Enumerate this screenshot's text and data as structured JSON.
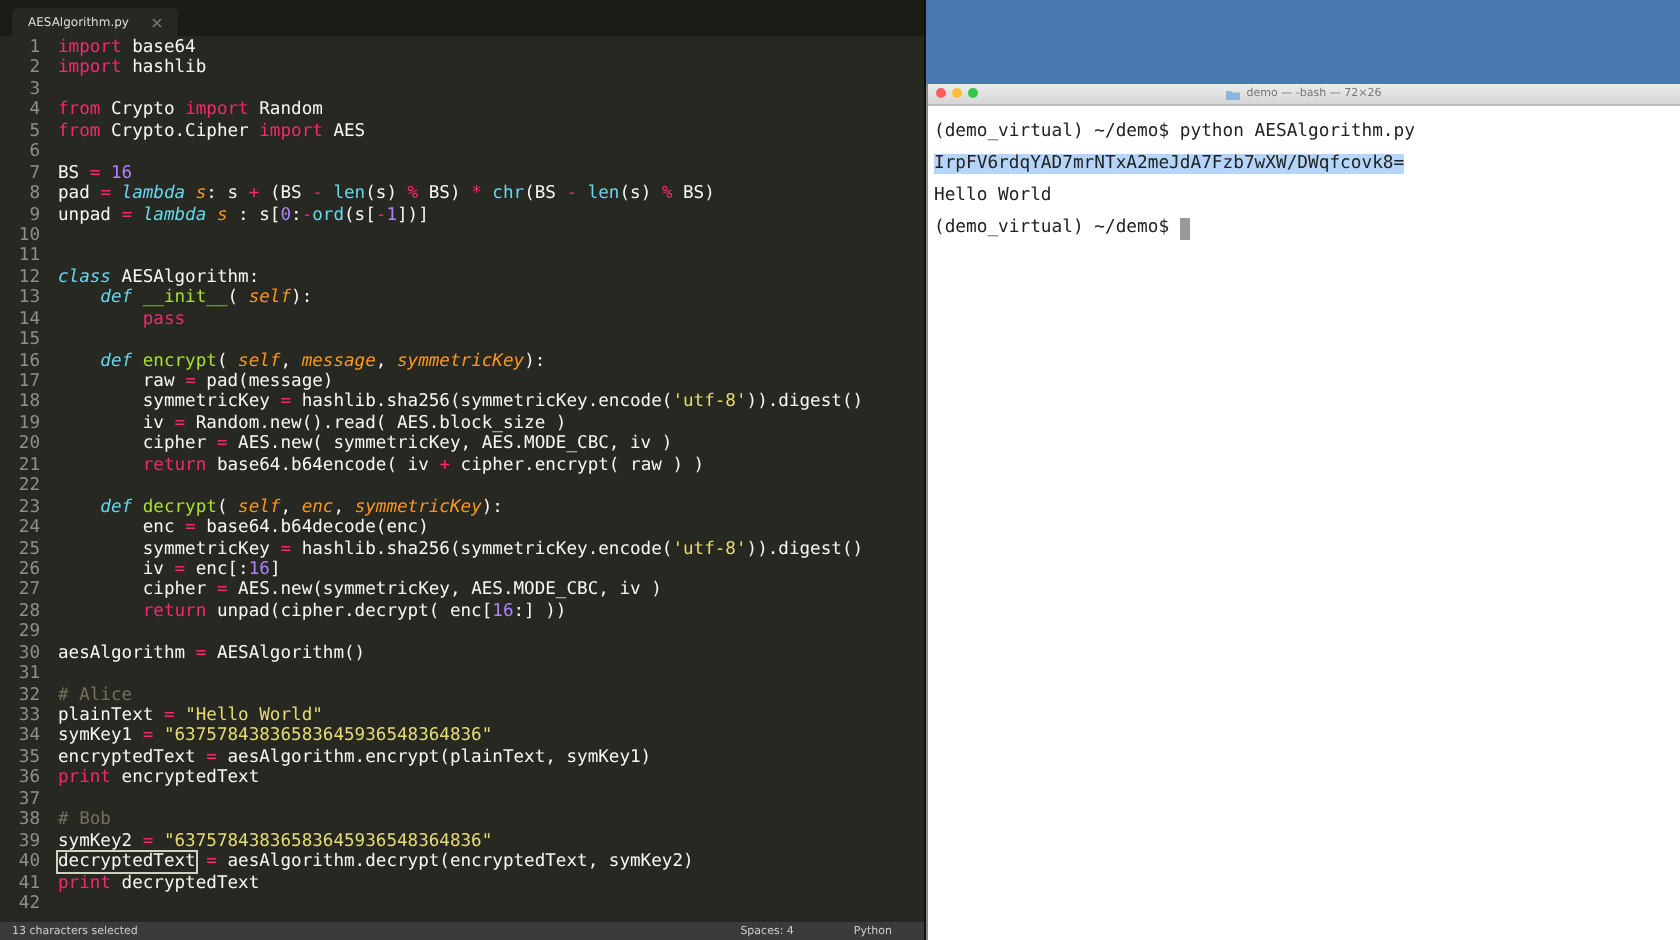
{
  "editor": {
    "tab": {
      "label": "AESAlgorithm.py",
      "selected": true
    },
    "lines": [
      {
        "number": "1",
        "tokens": [
          {
            "kind": "keyword",
            "text": "import "
          },
          {
            "kind": "plain",
            "text": "base64"
          }
        ]
      },
      {
        "number": "2",
        "tokens": [
          {
            "kind": "keyword",
            "text": "import "
          },
          {
            "kind": "plain",
            "text": "hashlib"
          }
        ]
      },
      {
        "number": "3"
      },
      {
        "number": "4",
        "tokens": [
          {
            "kind": "keyword",
            "text": "from "
          },
          {
            "kind": "plain",
            "text": "Crypto "
          },
          {
            "kind": "keyword",
            "text": "import "
          },
          {
            "kind": "plain",
            "text": "Random"
          }
        ]
      },
      {
        "number": "5",
        "tokens": [
          {
            "kind": "keyword",
            "text": "from "
          },
          {
            "kind": "plain",
            "text": "Crypto.Cipher "
          },
          {
            "kind": "keyword",
            "text": "import "
          },
          {
            "kind": "plain",
            "text": "AES"
          }
        ]
      },
      {
        "number": "6"
      },
      {
        "number": "7",
        "tokens": [
          {
            "kind": "plain",
            "text": "BS "
          },
          {
            "kind": "keyword",
            "text": "= "
          },
          {
            "kind": "number",
            "text": "16"
          }
        ]
      },
      {
        "number": "8",
        "tokens": [
          {
            "kind": "plain",
            "text": "pad "
          },
          {
            "kind": "keyword",
            "text": "= "
          },
          {
            "kind": "storage",
            "text": "lambda "
          },
          {
            "kind": "parameter",
            "text": "s"
          },
          {
            "kind": "plain",
            "text": ": s "
          },
          {
            "kind": "keyword",
            "text": "+ "
          },
          {
            "kind": "plain",
            "text": "(BS "
          },
          {
            "kind": "keyword",
            "text": "- "
          },
          {
            "kind": "builtin",
            "text": "len"
          },
          {
            "kind": "plain",
            "text": "(s) "
          },
          {
            "kind": "keyword",
            "text": "% "
          },
          {
            "kind": "plain",
            "text": "BS) "
          },
          {
            "kind": "keyword",
            "text": "* "
          },
          {
            "kind": "builtin",
            "text": "chr"
          },
          {
            "kind": "plain",
            "text": "(BS "
          },
          {
            "kind": "keyword",
            "text": "- "
          },
          {
            "kind": "builtin",
            "text": "len"
          },
          {
            "kind": "plain",
            "text": "(s) "
          },
          {
            "kind": "keyword",
            "text": "% "
          },
          {
            "kind": "plain",
            "text": "BS)"
          }
        ]
      },
      {
        "number": "9",
        "tokens": [
          {
            "kind": "plain",
            "text": "unpad "
          },
          {
            "kind": "keyword",
            "text": "= "
          },
          {
            "kind": "storage",
            "text": "lambda "
          },
          {
            "kind": "parameter",
            "text": "s "
          },
          {
            "kind": "plain",
            "text": ": s["
          },
          {
            "kind": "number",
            "text": "0"
          },
          {
            "kind": "plain",
            "text": ":"
          },
          {
            "kind": "keyword",
            "text": "-"
          },
          {
            "kind": "builtin",
            "text": "ord"
          },
          {
            "kind": "plain",
            "text": "(s["
          },
          {
            "kind": "keyword",
            "text": "-"
          },
          {
            "kind": "number",
            "text": "1"
          },
          {
            "kind": "plain",
            "text": "])]"
          }
        ]
      },
      {
        "number": "10"
      },
      {
        "number": "11"
      },
      {
        "number": "12",
        "tokens": [
          {
            "kind": "storage",
            "text": "class "
          },
          {
            "kind": "plain",
            "text": "AESAlgorithm:"
          }
        ]
      },
      {
        "number": "13",
        "tokens": [
          {
            "kind": "storage",
            "text": "    def "
          },
          {
            "kind": "function",
            "text": "__init__"
          },
          {
            "kind": "plain",
            "text": "( "
          },
          {
            "kind": "parameter",
            "text": "self"
          },
          {
            "kind": "plain",
            "text": "):"
          }
        ]
      },
      {
        "number": "14",
        "tokens": [
          {
            "kind": "keyword",
            "text": "        pass"
          }
        ]
      },
      {
        "number": "15"
      },
      {
        "number": "16",
        "tokens": [
          {
            "kind": "storage",
            "text": "    def "
          },
          {
            "kind": "function",
            "text": "encrypt"
          },
          {
            "kind": "plain",
            "text": "( "
          },
          {
            "kind": "parameter",
            "text": "self"
          },
          {
            "kind": "plain",
            "text": ", "
          },
          {
            "kind": "parameter",
            "text": "message"
          },
          {
            "kind": "plain",
            "text": ", "
          },
          {
            "kind": "parameter",
            "text": "symmetricKey"
          },
          {
            "kind": "plain",
            "text": "):"
          }
        ]
      },
      {
        "number": "17",
        "tokens": [
          {
            "kind": "plain",
            "text": "        raw "
          },
          {
            "kind": "keyword",
            "text": "= "
          },
          {
            "kind": "plain",
            "text": "pad(message)"
          }
        ]
      },
      {
        "number": "18",
        "tokens": [
          {
            "kind": "plain",
            "text": "        symmetricKey "
          },
          {
            "kind": "keyword",
            "text": "= "
          },
          {
            "kind": "plain",
            "text": "hashlib.sha256(symmetricKey.encode("
          },
          {
            "kind": "string",
            "text": "'utf-8'"
          },
          {
            "kind": "plain",
            "text": ")).digest()"
          }
        ]
      },
      {
        "number": "19",
        "tokens": [
          {
            "kind": "plain",
            "text": "        iv "
          },
          {
            "kind": "keyword",
            "text": "= "
          },
          {
            "kind": "plain",
            "text": "Random.new().read( AES.block_size )"
          }
        ]
      },
      {
        "number": "20",
        "tokens": [
          {
            "kind": "plain",
            "text": "        cipher "
          },
          {
            "kind": "keyword",
            "text": "= "
          },
          {
            "kind": "plain",
            "text": "AES.new( symmetricKey, AES.MODE_CBC, iv )"
          }
        ]
      },
      {
        "number": "21",
        "tokens": [
          {
            "kind": "keyword",
            "text": "        return "
          },
          {
            "kind": "plain",
            "text": "base64.b64encode( iv "
          },
          {
            "kind": "keyword",
            "text": "+ "
          },
          {
            "kind": "plain",
            "text": "cipher.encrypt( raw ) )"
          }
        ]
      },
      {
        "number": "22"
      },
      {
        "number": "23",
        "tokens": [
          {
            "kind": "storage",
            "text": "    def "
          },
          {
            "kind": "function",
            "text": "decrypt"
          },
          {
            "kind": "plain",
            "text": "( "
          },
          {
            "kind": "parameter",
            "text": "self"
          },
          {
            "kind": "plain",
            "text": ", "
          },
          {
            "kind": "parameter",
            "text": "enc"
          },
          {
            "kind": "plain",
            "text": ", "
          },
          {
            "kind": "parameter",
            "text": "symmetricKey"
          },
          {
            "kind": "plain",
            "text": "):"
          }
        ]
      },
      {
        "number": "24",
        "tokens": [
          {
            "kind": "plain",
            "text": "        enc "
          },
          {
            "kind": "keyword",
            "text": "= "
          },
          {
            "kind": "plain",
            "text": "base64.b64decode(enc)"
          }
        ]
      },
      {
        "number": "25",
        "tokens": [
          {
            "kind": "plain",
            "text": "        symmetricKey "
          },
          {
            "kind": "keyword",
            "text": "= "
          },
          {
            "kind": "plain",
            "text": "hashlib.sha256(symmetricKey.encode("
          },
          {
            "kind": "string",
            "text": "'utf-8'"
          },
          {
            "kind": "plain",
            "text": ")).digest()"
          }
        ]
      },
      {
        "number": "26",
        "tokens": [
          {
            "kind": "plain",
            "text": "        iv "
          },
          {
            "kind": "keyword",
            "text": "= "
          },
          {
            "kind": "plain",
            "text": "enc[:"
          },
          {
            "kind": "number",
            "text": "16"
          },
          {
            "kind": "plain",
            "text": "]"
          }
        ]
      },
      {
        "number": "27",
        "tokens": [
          {
            "kind": "plain",
            "text": "        cipher "
          },
          {
            "kind": "keyword",
            "text": "= "
          },
          {
            "kind": "plain",
            "text": "AES.new(symmetricKey, AES.MODE_CBC, iv )"
          }
        ]
      },
      {
        "number": "28",
        "tokens": [
          {
            "kind": "keyword",
            "text": "        return "
          },
          {
            "kind": "plain",
            "text": "unpad(cipher.decrypt( enc["
          },
          {
            "kind": "number",
            "text": "16"
          },
          {
            "kind": "plain",
            "text": ":] ))"
          }
        ]
      },
      {
        "number": "29"
      },
      {
        "number": "30",
        "tokens": [
          {
            "kind": "plain",
            "text": "aesAlgorithm "
          },
          {
            "kind": "keyword",
            "text": "= "
          },
          {
            "kind": "plain",
            "text": "AESAlgorithm()"
          }
        ]
      },
      {
        "number": "31"
      },
      {
        "number": "32",
        "tokens": [
          {
            "kind": "comment",
            "text": "# Alice"
          }
        ]
      },
      {
        "number": "33",
        "tokens": [
          {
            "kind": "plain",
            "text": "plainText "
          },
          {
            "kind": "keyword",
            "text": "= "
          },
          {
            "kind": "string",
            "text": "\"Hello World\""
          }
        ]
      },
      {
        "number": "34",
        "tokens": [
          {
            "kind": "plain",
            "text": "symKey1 "
          },
          {
            "kind": "keyword",
            "text": "= "
          },
          {
            "kind": "string",
            "text": "\"63757843836583645936548364836\""
          }
        ]
      },
      {
        "number": "35",
        "tokens": [
          {
            "kind": "plain",
            "text": "encryptedText "
          },
          {
            "kind": "keyword",
            "text": "= "
          },
          {
            "kind": "plain",
            "text": "aesAlgorithm.encrypt(plainText, symKey1)"
          }
        ]
      },
      {
        "number": "36",
        "tokens": [
          {
            "kind": "keyword",
            "text": "print "
          },
          {
            "kind": "plain",
            "text": "encryptedText"
          }
        ]
      },
      {
        "number": "37"
      },
      {
        "number": "38",
        "tokens": [
          {
            "kind": "comment",
            "text": "# Bob"
          }
        ]
      },
      {
        "number": "39",
        "tokens": [
          {
            "kind": "plain",
            "text": "symKey2 "
          },
          {
            "kind": "keyword",
            "text": "= "
          },
          {
            "kind": "string",
            "text": "\"63757843836583645936548364836\""
          }
        ]
      },
      {
        "number": "40",
        "tokens": [
          {
            "kind": "match",
            "text": "decryptedText"
          },
          {
            "kind": "keyword",
            "text": " = "
          },
          {
            "kind": "plain",
            "text": "aesAlgorithm.decrypt(encryptedText, symKey2)"
          }
        ]
      },
      {
        "number": "41",
        "tokens": [
          {
            "kind": "keyword",
            "text": "print "
          },
          {
            "kind": "plain",
            "text": "decryptedText"
          }
        ]
      },
      {
        "number": "42"
      }
    ]
  },
  "status_bar": {
    "selection": "13 characters selected",
    "indent": "Spaces: 4",
    "syntax": "Python"
  },
  "terminal": {
    "title": "demo — -bash — 72×26",
    "lines": [
      {
        "text": "(demo_virtual) ~/demo$ python AESAlgorithm.py",
        "selected": false
      },
      {
        "text": "IrpFV6rdqYAD7mrNTxA2meJdA7Fzb7wXW/DWqfcovk8=",
        "selected": true
      },
      {
        "text": "Hello World",
        "selected": false
      },
      {
        "text": "(demo_virtual) ~/demo$",
        "selected": false
      }
    ]
  }
}
